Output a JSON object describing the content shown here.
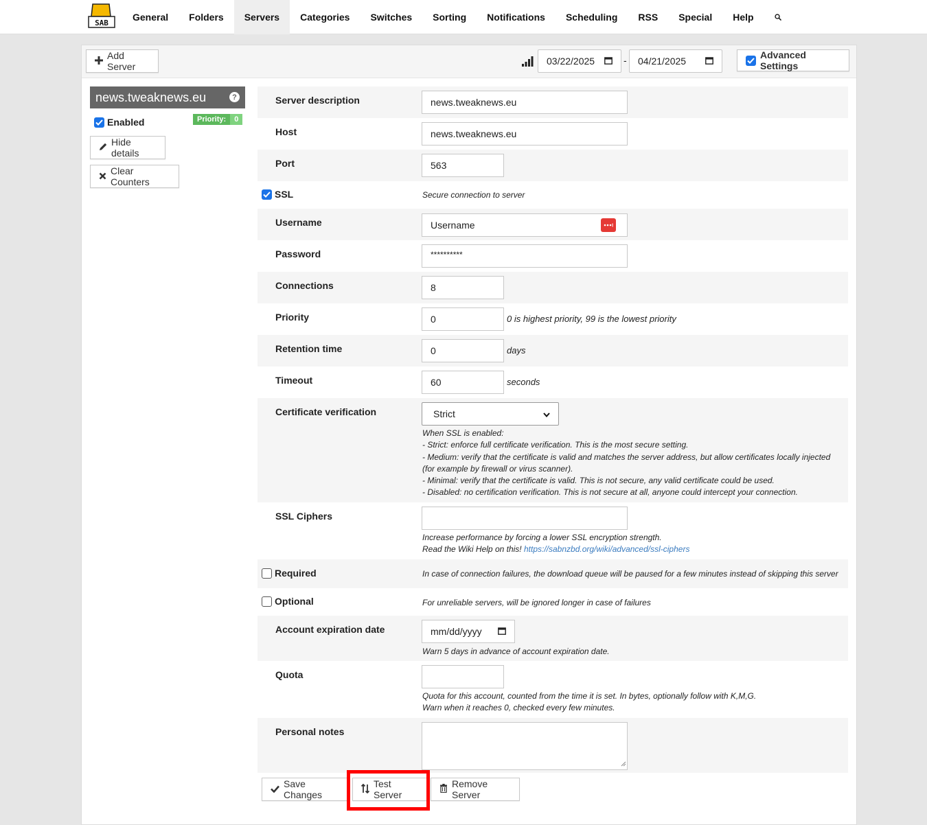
{
  "nav": {
    "items": [
      "General",
      "Folders",
      "Servers",
      "Categories",
      "Switches",
      "Sorting",
      "Notifications",
      "Scheduling",
      "RSS",
      "Special",
      "Help"
    ],
    "active": "Servers",
    "search_icon": "search-icon"
  },
  "toolbar": {
    "add_server": "Add Server",
    "date_from": "03/22/2025",
    "date_sep": "-",
    "date_to": "04/21/2025",
    "advanced_settings": "Advanced Settings"
  },
  "server": {
    "title": "news.tweaknews.eu",
    "help": "?",
    "enabled_label": "Enabled",
    "priority_label": "Priority:",
    "priority_value": "0",
    "hide_details": "Hide details",
    "clear_counters": "Clear Counters"
  },
  "form": {
    "description": {
      "label": "Server description",
      "value": "news.tweaknews.eu"
    },
    "host": {
      "label": "Host",
      "value": "news.tweaknews.eu"
    },
    "port": {
      "label": "Port",
      "value": "563"
    },
    "ssl": {
      "label": "SSL",
      "desc": "Secure connection to server"
    },
    "username": {
      "label": "Username",
      "value": "Username"
    },
    "password": {
      "label": "Password",
      "value": "**********"
    },
    "connections": {
      "label": "Connections",
      "value": "8"
    },
    "priority": {
      "label": "Priority",
      "value": "0",
      "desc": "0 is highest priority, 99 is the lowest priority"
    },
    "retention": {
      "label": "Retention time",
      "value": "0",
      "unit": "days"
    },
    "timeout": {
      "label": "Timeout",
      "value": "60",
      "unit": "seconds"
    },
    "cert": {
      "label": "Certificate verification",
      "value": "Strict",
      "desc": [
        "When SSL is enabled:",
        "- Strict: enforce full certificate verification. This is the most secure setting.",
        "- Medium: verify that the certificate is valid and matches the server address, but allow certificates locally injected",
        "(for example by firewall or virus scanner).",
        "- Minimal: verify that the certificate is valid. This is not secure, any valid certificate could be used.",
        "- Disabled: no certification verification. This is not secure at all, anyone could intercept your connection."
      ]
    },
    "ciphers": {
      "label": "SSL Ciphers",
      "value": "",
      "desc1": "Increase performance by forcing a lower SSL encryption strength.",
      "desc2": "Read the Wiki Help on this!",
      "link": "https://sabnzbd.org/wiki/advanced/ssl-ciphers"
    },
    "required": {
      "label": "Required",
      "desc": "In case of connection failures, the download queue will be paused for a few minutes instead of skipping this server"
    },
    "optional": {
      "label": "Optional",
      "desc": "For unreliable servers, will be ignored longer in case of failures"
    },
    "expiration": {
      "label": "Account expiration date",
      "value": "mm/dd/yyyy",
      "desc": "Warn 5 days in advance of account expiration date."
    },
    "quota": {
      "label": "Quota",
      "value": "",
      "desc1": "Quota for this account, counted from the time it is set. In bytes, optionally follow with K,M,G.",
      "desc2": "Warn when it reaches 0, checked every few minutes."
    },
    "notes": {
      "label": "Personal notes",
      "value": ""
    }
  },
  "actions": {
    "save": "Save Changes",
    "test": "Test Server",
    "remove": "Remove Server"
  },
  "colors": {
    "highlight": "#ff0000",
    "checkbox": "#1a73e8",
    "priority_badge": "#5cb85c"
  }
}
